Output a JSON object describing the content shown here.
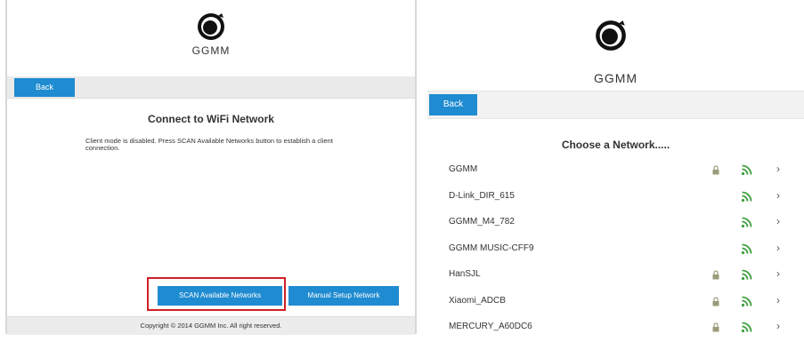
{
  "left_screen": {
    "brand": "GGMM",
    "back_label": "Back",
    "heading": "Connect to WiFi Network",
    "message": "Client mode is disabled. Press SCAN Available Networks button to establish a client connection.",
    "scan_button": "SCAN Available Networks",
    "manual_button": "Manual Setup Network",
    "footer": "Copyright © 2014 GGMM Inc. All right reserved.",
    "highlight_color": "#d01f26"
  },
  "right_screen": {
    "brand": "GGMM",
    "back_label": "Back",
    "heading": "Choose a Network.....",
    "networks": [
      {
        "name": "GGMM",
        "locked": true
      },
      {
        "name": "D-Link_DIR_615",
        "locked": false
      },
      {
        "name": "GGMM_M4_782",
        "locked": false
      },
      {
        "name": "GGMM MUSIC-CFF9",
        "locked": false
      },
      {
        "name": "HanSJL",
        "locked": true
      },
      {
        "name": "Xiaomi_ADCB",
        "locked": true
      },
      {
        "name": "MERCURY_A60DC6",
        "locked": true
      }
    ]
  },
  "colors": {
    "accent": "#1f8bd0",
    "wifi": "#3f9f3f",
    "lock": "#9b9b7a"
  },
  "icons": {
    "logo": "ggmm-logo-icon",
    "lock": "lock-icon",
    "wifi": "wifi-signal-icon",
    "chevron": "chevron-right-icon"
  }
}
